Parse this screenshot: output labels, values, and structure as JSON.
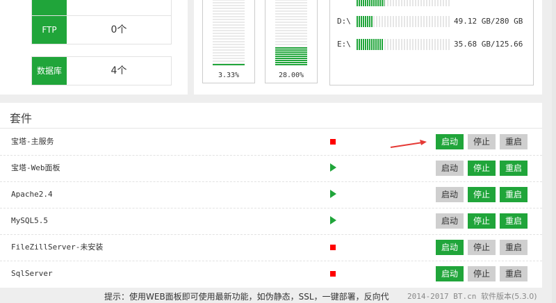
{
  "stats": [
    {
      "label": "FTP",
      "value": "0个"
    },
    {
      "label": "数据库",
      "value": "4个"
    }
  ],
  "gauges": [
    {
      "percent_label": "3.33%",
      "fill": 0.0333
    },
    {
      "percent_label": "28.00%",
      "fill": 0.28
    }
  ],
  "disks": [
    {
      "name": "D:\\",
      "usage": "49.12 GB/280 GB",
      "fill": 0.175
    },
    {
      "name": "E:\\",
      "usage": "35.68 GB/125.66",
      "fill": 0.284
    }
  ],
  "suite": {
    "title": "套件",
    "button_labels": {
      "start": "启动",
      "stop": "停止",
      "restart": "重启"
    },
    "services": [
      {
        "name": "宝塔-主服务",
        "status": "stopped"
      },
      {
        "name": "宝塔-Web面板",
        "status": "running"
      },
      {
        "name": "Apache2.4",
        "status": "running"
      },
      {
        "name": "MySQL5.5",
        "status": "running"
      },
      {
        "name": "FileZillServer-未安装",
        "status": "stopped"
      },
      {
        "name": "SqlServer",
        "status": "stopped"
      }
    ]
  },
  "footer": {
    "tip": "提示：使用WEB面板即可使用最新功能，如伪静态，SSL，一键部署，反向代",
    "copyright": "2014-2017 BT.cn",
    "version": "软件版本(5.3.0)"
  },
  "colors": {
    "accent": "#20a53a",
    "stopped": "#ff0000",
    "arrow": "#e53935"
  }
}
